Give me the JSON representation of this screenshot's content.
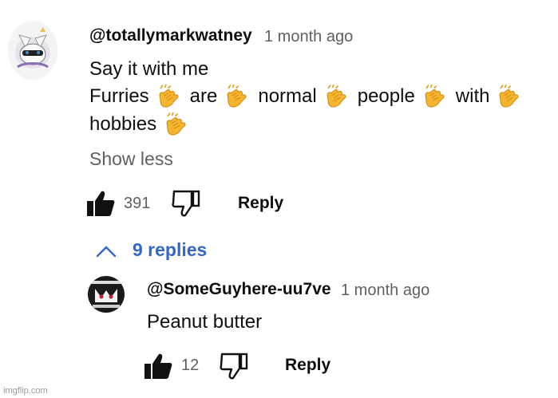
{
  "comment": {
    "author": "@totallymarkwatney",
    "time": "1 month ago",
    "line1": "Say it with me",
    "words_line2": [
      "Furries",
      "are",
      "normal",
      "people",
      "with"
    ],
    "words_line3": [
      "hobbies"
    ],
    "clap_icon": "clapping-hands-emoji",
    "show_less": "Show less",
    "likes": "391",
    "reply_label": "Reply",
    "replies_toggle": "9 replies"
  },
  "reply": {
    "author": "@SomeGuyhere-uu7ve",
    "time": "1 month ago",
    "text": "Peanut butter",
    "likes": "12",
    "reply_label": "Reply"
  },
  "watermark": "imgflip.com",
  "colors": {
    "link_blue": "#3366cc",
    "secondary_text": "#606060",
    "clap_yellow": "#f5b52e"
  }
}
